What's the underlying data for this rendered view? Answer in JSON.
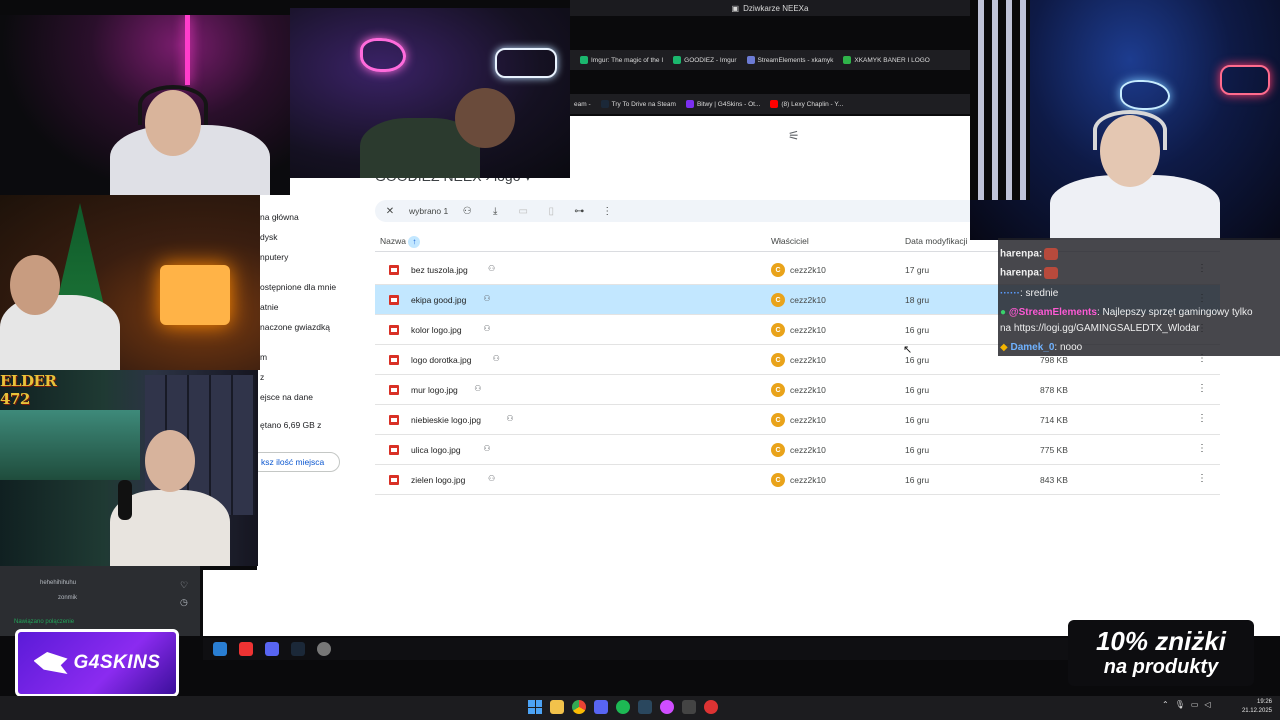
{
  "browser": {
    "window_title": "Dziwkarze NEEXa",
    "bookmarks_row1": [
      "Imgur: The magic of the I",
      "GOODIEZ - Imgur",
      "StreamElements - xkamyk",
      "XKAMYK BANER I LOGO"
    ],
    "bookmarks_row2": [
      "eam -",
      "Try To Drive na Steam",
      "Bitwy | G4Skins - Ot...",
      "(8) Lexy Chaplin - Y..."
    ]
  },
  "drive": {
    "breadcrumb": "GOODIEZ NEEX  ›  logo ▾",
    "sidebar": [
      "na główna",
      "dysk",
      "nputery",
      "ostępnione dla mnie",
      "atnie",
      "naczone gwiazdką",
      "m",
      "z",
      "ejsce na dane",
      "ętano 6,69 GB z"
    ],
    "storage_button": "ksz ilość miejsca",
    "selection": {
      "label": "wybrano 1"
    },
    "columns": {
      "name": "Nazwa",
      "owner": "Właściciel",
      "modified": "Data modyfikacji"
    },
    "files": [
      {
        "name": "bez tuszola.jpg",
        "owner": "cezz2k10",
        "date": "17 gru",
        "size": "",
        "selected": false
      },
      {
        "name": "ekipa good.jpg",
        "owner": "cezz2k10",
        "date": "18 gru",
        "size": "",
        "selected": true
      },
      {
        "name": "kolor logo.jpg",
        "owner": "cezz2k10",
        "date": "16 gru",
        "size": "",
        "selected": false
      },
      {
        "name": "logo dorotka.jpg",
        "owner": "cezz2k10",
        "date": "16 gru",
        "size": "798 KB",
        "selected": false
      },
      {
        "name": "mur logo.jpg",
        "owner": "cezz2k10",
        "date": "16 gru",
        "size": "878 KB",
        "selected": false
      },
      {
        "name": "niebieskie logo.jpg",
        "owner": "cezz2k10",
        "date": "16 gru",
        "size": "714 KB",
        "selected": false
      },
      {
        "name": "ulica logo.jpg",
        "owner": "cezz2k10",
        "date": "16 gru",
        "size": "775 KB",
        "selected": false
      },
      {
        "name": "zielen logo.jpg",
        "owner": "cezz2k10",
        "date": "16 gru",
        "size": "843 KB",
        "selected": false
      }
    ],
    "owner_initial": "C"
  },
  "overlay": {
    "elder_logo": "ELDER 472",
    "chat": [
      {
        "user": "harenpa:",
        "text": "",
        "user_color": "#ffffff"
      },
      {
        "user": "harenpa:",
        "text": "",
        "user_color": "#ffffff"
      },
      {
        "user": "",
        "text": ": srednie",
        "user_color": "#5a9cff"
      },
      {
        "user": "@StreamElements",
        "text": ": Najlepszy sprzęt gamingowy tylko",
        "user_color": "#ff5ad2"
      },
      {
        "user": "",
        "text": "na https://logi.gg/GAMINGSALEDTX_Wlodar",
        "user_color": "#ffffff"
      },
      {
        "user": "Damek_0",
        "text": ": nooo",
        "user_color": "#6fb2ff"
      }
    ],
    "g4skins": "G4SKINS",
    "promo_line1": "10% zniżki",
    "promo_line2": "na produkty",
    "discord_connected": "Nawiązano połączenie",
    "discord_users": [
      "hehehihihuhu",
      "zonmik"
    ]
  },
  "taskbar": {
    "clock_time": "19:26",
    "clock_date": "21.12.2025"
  },
  "colors": {
    "selection": "#c2e7ff",
    "drive_blue": "#0b57d0",
    "file_icon": "#d93025",
    "owner_avatar": "#e9a31a"
  }
}
